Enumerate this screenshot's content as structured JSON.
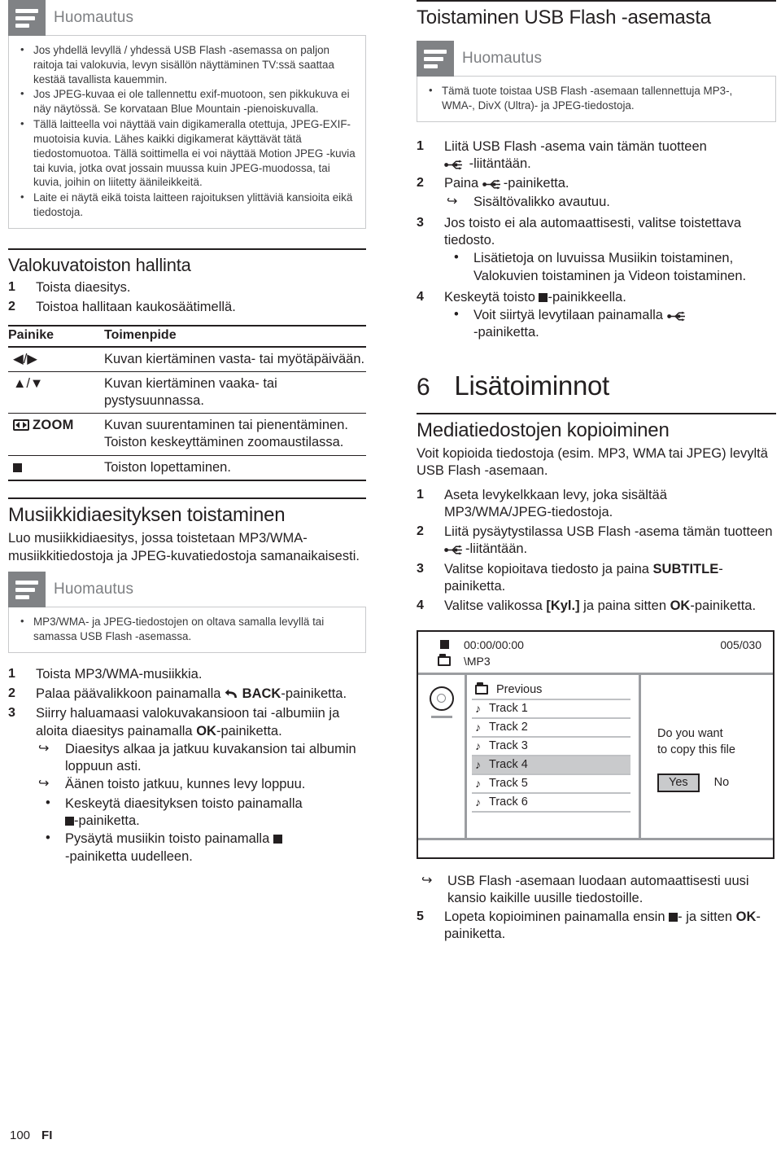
{
  "note_label": "Huomautus",
  "left": {
    "note1": {
      "title": "Huomautus",
      "items": [
        "Jos yhdellä levyllä / yhdessä USB Flash -asemassa on paljon raitoja tai valokuvia, levyn sisällön näyttäminen TV:ssä saattaa kestää tavallista kauemmin.",
        "Jos JPEG-kuvaa ei ole tallennettu exif-muotoon, sen pikkukuva ei näy näytössä. Se korvataan Blue Mountain -pienoiskuvalla.",
        "Tällä laitteella voi näyttää vain digikameralla otettuja, JPEG-EXIF-muotoisia kuvia. Lähes kaikki digikamerat käyttävät tätä tiedostomuotoa. Tällä soittimella ei voi näyttää Motion JPEG -kuvia tai kuvia, jotka ovat jossain muussa kuin JPEG-muodossa, tai kuvia, joihin on liitetty äänileikkeitä.",
        "Laite ei näytä eikä toista laitteen rajoituksen ylittäviä kansioita eikä tiedostoja."
      ]
    },
    "section1": {
      "heading": "Valokuvatoiston hallinta",
      "steps": [
        {
          "n": "1",
          "text": "Toista diaesitys."
        },
        {
          "n": "2",
          "text": "Toistoa hallitaan kaukosäätimellä."
        }
      ]
    },
    "table": {
      "col_button": "Painike",
      "col_action": "Toimenpide",
      "rows": [
        {
          "key": "◀/▶",
          "key_type": "text",
          "action": "Kuvan kiertäminen vasta- tai myötäpäivään."
        },
        {
          "key": "▲/▼",
          "key_type": "text",
          "action": "Kuvan kiertäminen vaaka- tai pystysuunnassa."
        },
        {
          "key": "ZOOM",
          "key_type": "zoom",
          "action": "Kuvan suurentaminen tai pienentäminen.",
          "action2": "Toiston keskeyttäminen zoomaustilassa."
        },
        {
          "key": "",
          "key_type": "stop",
          "action": "Toiston lopettaminen."
        }
      ]
    },
    "section2": {
      "heading": "Musiikkidiaesityksen toistaminen",
      "intro": "Luo musiikkidiaesitys, jossa toistetaan MP3/WMA-musiikkitiedostoja ja JPEG-kuvatiedostoja samanaikaisesti.",
      "note": {
        "title": "Huomautus",
        "items": [
          "MP3/WMA- ja JPEG-tiedostojen on oltava samalla levyllä tai samassa USB Flash -asemassa."
        ]
      },
      "steps": [
        {
          "n": "1",
          "pre": "Toista MP3/WMA-musiikkia.",
          "post": ""
        },
        {
          "n": "2",
          "pre": "Palaa päävalikkoon painamalla ",
          "bold": "BACK",
          "post": "-painiketta.",
          "icon": "back"
        },
        {
          "n": "3",
          "pre": "Siirry haluamaasi valokuvakansioon tai -albumiin ja aloita diaesitys painamalla ",
          "bold": "OK",
          "post": "-painiketta."
        }
      ],
      "arrows": [
        "Diaesitys alkaa ja jatkuu kuvakansion tai albumin loppuun asti.",
        "Äänen toisto jatkuu, kunnes levy loppuu."
      ],
      "bullets": [
        {
          "pre": "Keskeytä diaesityksen toisto painamalla ",
          "post": "-painiketta.",
          "icon": "stop",
          "icon_pos": "line2"
        },
        {
          "pre": "Pysäytä musiikin toisto painamalla ",
          "post": "-painiketta uudelleen.",
          "icon": "stop",
          "icon_pos": "inline"
        }
      ]
    }
  },
  "right": {
    "section1": {
      "heading": "Toistaminen USB Flash -asemasta"
    },
    "note1": {
      "title": "Huomautus",
      "items": [
        "Tämä tuote toistaa USB Flash -asemaan tallennettuja MP3-, WMA-, DivX (Ultra)- ja JPEG-tiedostoja."
      ]
    },
    "steps": [
      {
        "n": "1",
        "pre": "Liitä USB Flash -asema vain tämän tuotteen ",
        "post": " -liitäntään.",
        "icon": "usb"
      },
      {
        "n": "2",
        "pre": "Paina ",
        "post": "-painiketta.",
        "icon": "usb"
      },
      {
        "n": "3",
        "pre": "Jos toisto ei ala automaattisesti, valitse toistettava tiedosto.",
        "post": ""
      },
      {
        "n": "4",
        "pre": "Keskeytä toisto ",
        "post": "-painikkeella.",
        "icon": "stop"
      }
    ],
    "step2_arrow": "Sisältövalikko avautuu.",
    "step3_bullet": "Lisätietoja on luvuissa Musiikin toistaminen, Valokuvien toistaminen ja Videon toistaminen.",
    "step4_bullet": {
      "pre": "Voit siirtyä levytilaan painamalla ",
      "post": "-painiketta.",
      "icon": "usb"
    },
    "chapter": {
      "num": "6",
      "title": "Lisätoiminnot"
    },
    "section2": {
      "heading": "Mediatiedostojen kopioiminen",
      "intro": "Voit kopioida tiedostoja (esim. MP3, WMA tai JPEG) levyltä USB Flash -asemaan.",
      "steps": [
        {
          "n": "1",
          "pre": "Aseta levykelkkaan levy, joka sisältää MP3/WMA/JPEG-tiedostoja.",
          "post": ""
        },
        {
          "n": "2",
          "pre": "Liitä pysäytystilassa USB Flash -asema tämän tuotteen ",
          "post": "-liitäntään.",
          "icon": "usb"
        },
        {
          "n": "3",
          "pre": "Valitse kopioitava tiedosto ja paina ",
          "bold": "SUBTITLE",
          "post": "-painiketta."
        },
        {
          "n": "4",
          "pre": "Valitse valikossa ",
          "bold": "[Kyl.]",
          "mid": " ja paina sitten ",
          "bold2": "OK",
          "post": "-painiketta."
        }
      ]
    },
    "screenshot": {
      "time": "00:00/00:00",
      "count": "005/030",
      "path": "\\MP3",
      "previous": "Previous",
      "tracks": [
        "Track 1",
        "Track 2",
        "Track 3",
        "Track 4",
        "Track 5",
        "Track 6"
      ],
      "selected_index": 3,
      "prompt_line1": "Do you want",
      "prompt_line2": "to copy this file",
      "yes": "Yes",
      "no": "No"
    },
    "after_shot": {
      "arrow": "USB Flash -asemaan luodaan automaattisesti uusi kansio kaikille uusille tiedostoille.",
      "step5": {
        "n": "5",
        "pre": "Lopeta kopioiminen painamalla ensin ",
        "mid": "- ja sitten ",
        "bold": "OK",
        "post": "-painiketta.",
        "icon": "stop"
      }
    }
  },
  "footer": {
    "page": "100",
    "lang": "FI"
  }
}
